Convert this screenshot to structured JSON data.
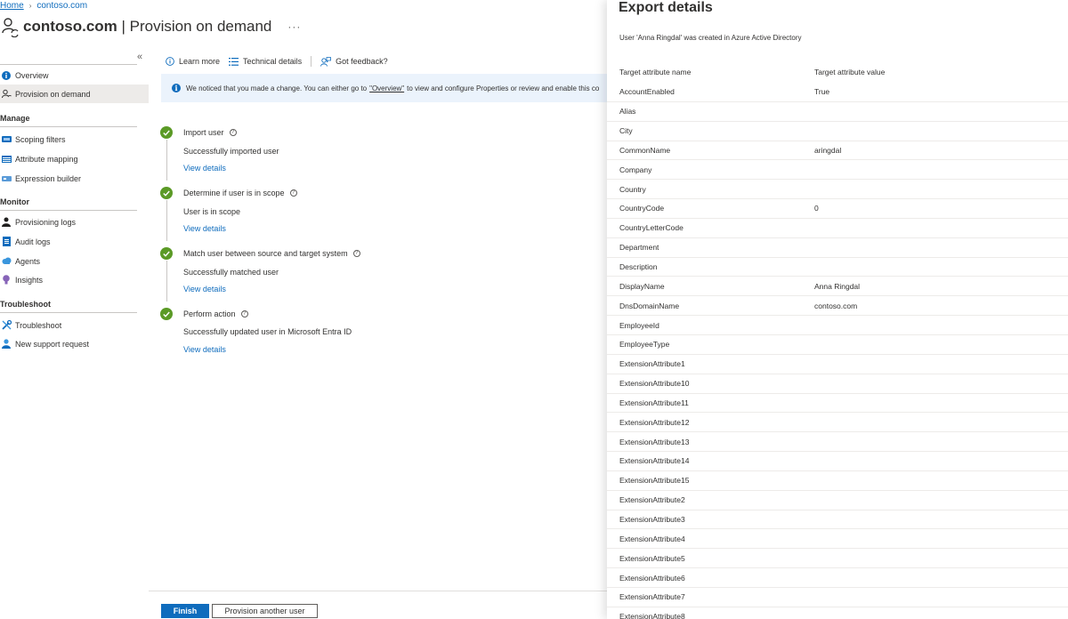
{
  "breadcrumb": {
    "home": "Home",
    "current": "contoso.com"
  },
  "header": {
    "title_bold": "contoso.com",
    "title_rest": "| Provision on demand",
    "more": "···"
  },
  "sidebar": {
    "collapse": "«",
    "items_top": [
      {
        "label": "Overview",
        "icon": "info-icon"
      },
      {
        "label": "Provision on demand",
        "icon": "person-sync-icon",
        "selected": true
      }
    ],
    "groups": [
      {
        "label": "Manage",
        "items": [
          {
            "label": "Scoping filters",
            "icon": "scoping-icon"
          },
          {
            "label": "Attribute mapping",
            "icon": "mapping-icon"
          },
          {
            "label": "Expression builder",
            "icon": "expression-icon"
          }
        ]
      },
      {
        "label": "Monitor",
        "items": [
          {
            "label": "Provisioning logs",
            "icon": "person-icon"
          },
          {
            "label": "Audit logs",
            "icon": "document-icon"
          },
          {
            "label": "Agents",
            "icon": "cloud-icon"
          },
          {
            "label": "Insights",
            "icon": "lightbulb-icon"
          }
        ]
      },
      {
        "label": "Troubleshoot",
        "items": [
          {
            "label": "Troubleshoot",
            "icon": "wrench-icon"
          },
          {
            "label": "New support request",
            "icon": "support-icon"
          }
        ]
      }
    ]
  },
  "toolbar": {
    "learn_more": "Learn more",
    "technical_details": "Technical details",
    "feedback": "Got feedback?"
  },
  "banner": {
    "text_before": "We noticed that you made a change. You can either go to",
    "link": "\"Overview\"",
    "text_after": "to view and configure Properties or review and enable this co"
  },
  "steps": [
    {
      "title": "Import user",
      "desc": "Successfully imported user",
      "link": "View details"
    },
    {
      "title": "Determine if user is in scope",
      "desc": "User is in scope",
      "link": "View details"
    },
    {
      "title": "Match user between source and target system",
      "desc": "Successfully matched user",
      "link": "View details"
    },
    {
      "title": "Perform action",
      "desc": "Successfully updated user in Microsoft Entra ID",
      "link": "View details"
    }
  ],
  "footer": {
    "finish": "Finish",
    "provision_another": "Provision another user"
  },
  "panel": {
    "title": "Export details",
    "subtitle": "User 'Anna Ringdal' was created in Azure Active Directory",
    "col_name": "Target attribute name",
    "col_value": "Target attribute value",
    "rows": [
      {
        "name": "AccountEnabled",
        "value": "True"
      },
      {
        "name": "Alias",
        "value": ""
      },
      {
        "name": "City",
        "value": ""
      },
      {
        "name": "CommonName",
        "value": "aringdal"
      },
      {
        "name": "Company",
        "value": ""
      },
      {
        "name": "Country",
        "value": ""
      },
      {
        "name": "CountryCode",
        "value": "0"
      },
      {
        "name": "CountryLetterCode",
        "value": ""
      },
      {
        "name": "Department",
        "value": ""
      },
      {
        "name": "Description",
        "value": ""
      },
      {
        "name": "DisplayName",
        "value": "Anna Ringdal"
      },
      {
        "name": "DnsDomainName",
        "value": "contoso.com"
      },
      {
        "name": "EmployeeId",
        "value": ""
      },
      {
        "name": "EmployeeType",
        "value": ""
      },
      {
        "name": "ExtensionAttribute1",
        "value": ""
      },
      {
        "name": "ExtensionAttribute10",
        "value": ""
      },
      {
        "name": "ExtensionAttribute11",
        "value": ""
      },
      {
        "name": "ExtensionAttribute12",
        "value": ""
      },
      {
        "name": "ExtensionAttribute13",
        "value": ""
      },
      {
        "name": "ExtensionAttribute14",
        "value": ""
      },
      {
        "name": "ExtensionAttribute15",
        "value": ""
      },
      {
        "name": "ExtensionAttribute2",
        "value": ""
      },
      {
        "name": "ExtensionAttribute3",
        "value": ""
      },
      {
        "name": "ExtensionAttribute4",
        "value": ""
      },
      {
        "name": "ExtensionAttribute5",
        "value": ""
      },
      {
        "name": "ExtensionAttribute6",
        "value": ""
      },
      {
        "name": "ExtensionAttribute7",
        "value": ""
      },
      {
        "name": "ExtensionAttribute8",
        "value": ""
      }
    ]
  }
}
